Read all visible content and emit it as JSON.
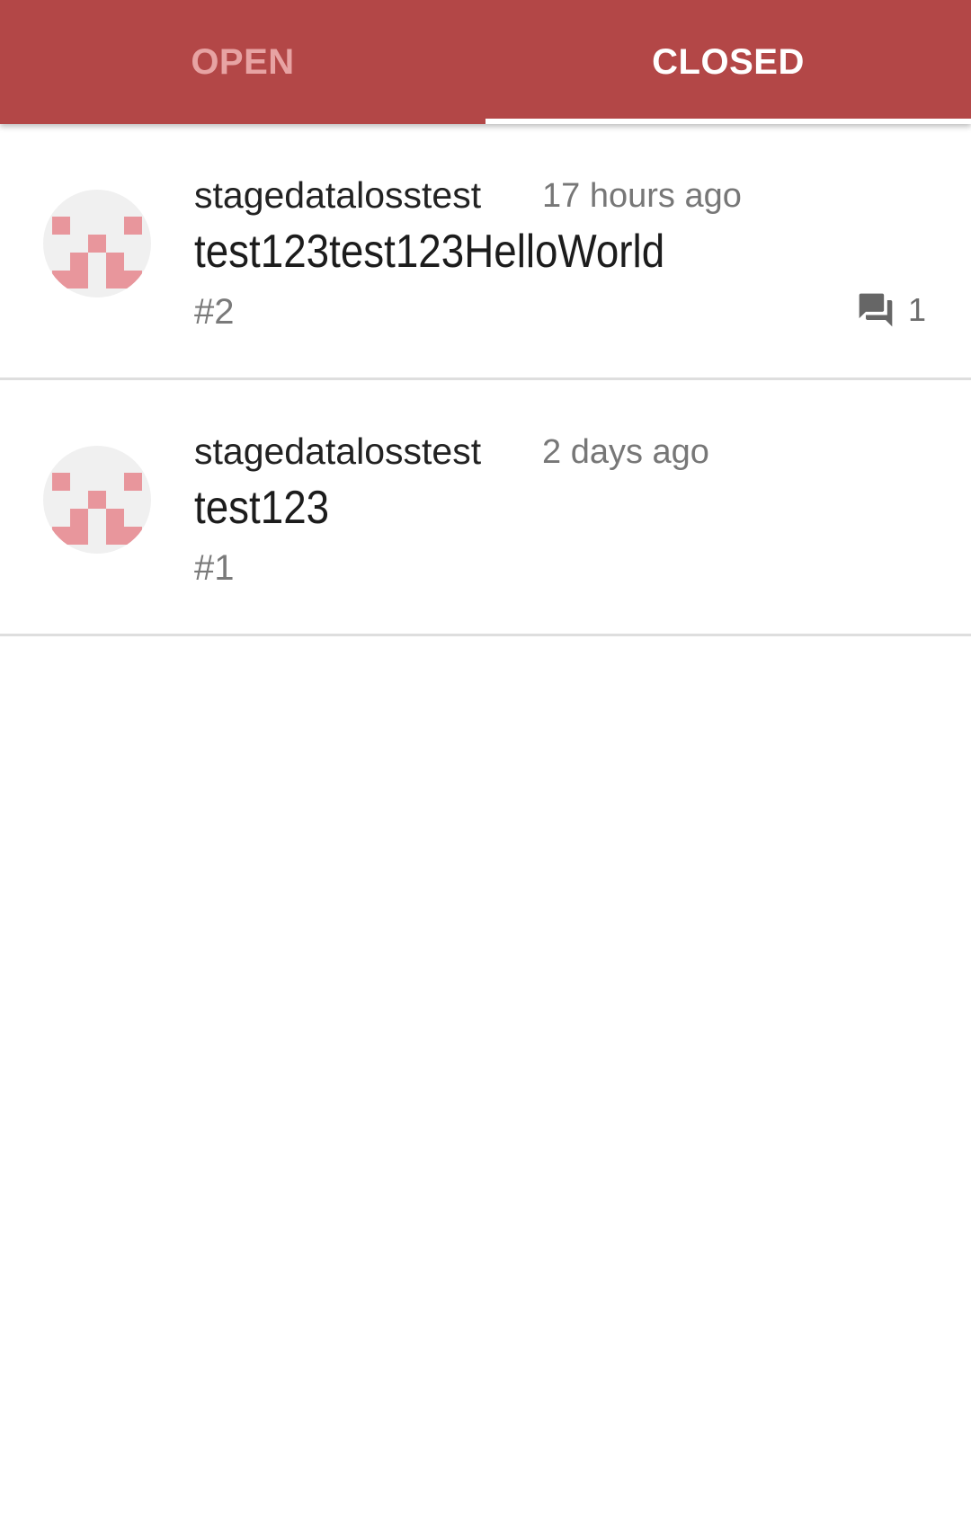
{
  "tabs": {
    "open_label": "OPEN",
    "closed_label": "CLOSED",
    "active": "closed"
  },
  "colors": {
    "accent": "#b34747",
    "avatar_pattern": "#e8969c",
    "divider": "#dedede"
  },
  "issues": [
    {
      "author": "stagedatalosstest",
      "time_ago": "17 hours ago",
      "title": "test123test123HelloWorld",
      "number": "#2",
      "comment_count": "1",
      "avatar_icon": "identicon-avatar",
      "comment_icon": "forum-icon"
    },
    {
      "author": "stagedatalosstest",
      "time_ago": "2 days ago",
      "title": "test123",
      "number": "#1",
      "avatar_icon": "identicon-avatar"
    }
  ]
}
